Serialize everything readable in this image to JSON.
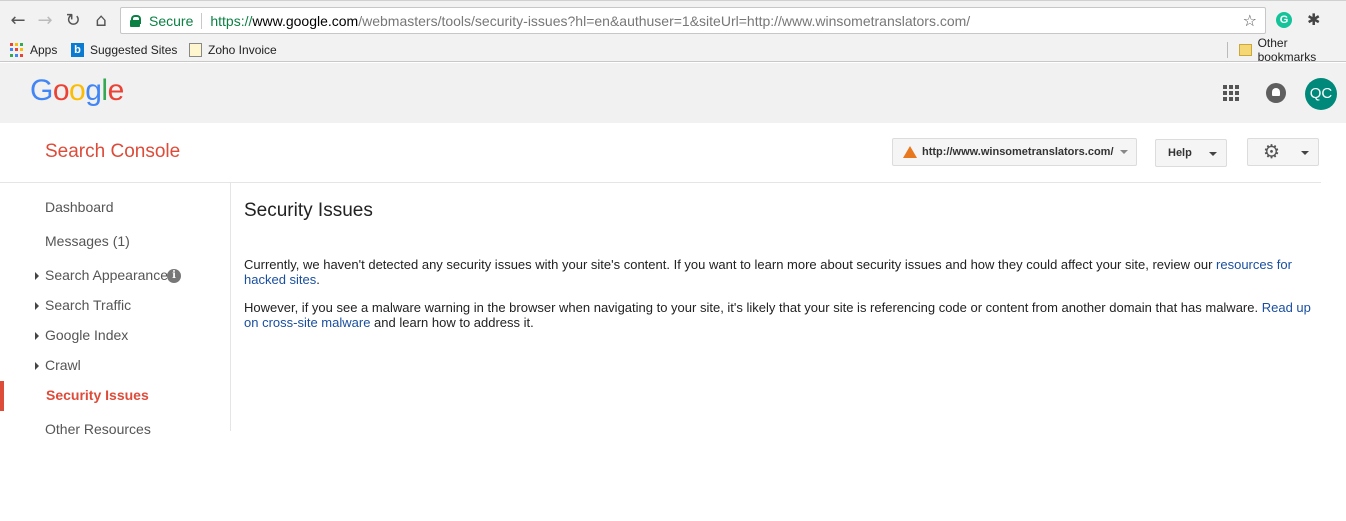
{
  "browser": {
    "secure_label": "Secure",
    "url_scheme": "https://",
    "url_host": "www.google.com",
    "url_path": "/webmasters/tools/security-issues?hl=en&authuser=1&siteUrl=http://www.winsometranslators.com/",
    "grammarly_letter": "G",
    "bookmarks": {
      "apps": "Apps",
      "suggested_sites": "Suggested Sites",
      "zoho_invoice": "Zoho Invoice",
      "suggested_letter": "b",
      "other": "Other bookmarks"
    }
  },
  "google_header": {
    "logo_letters": [
      "G",
      "o",
      "o",
      "g",
      "l",
      "e"
    ],
    "avatar_initials": "QC"
  },
  "console": {
    "title": "Search Console",
    "site_selector": "http://www.winsometranslators.com/",
    "help_label": "Help"
  },
  "sidebar": {
    "items": [
      {
        "label": "Dashboard"
      },
      {
        "label": "Messages (1)"
      },
      {
        "label": "Search Appearance"
      },
      {
        "label": "Search Traffic"
      },
      {
        "label": "Google Index"
      },
      {
        "label": "Crawl"
      },
      {
        "label": "Security Issues"
      },
      {
        "label": "Other Resources"
      }
    ],
    "info_glyph": "i"
  },
  "main": {
    "title": "Security Issues",
    "para1_text": "Currently, we haven't detected any security issues with your site's content. If you want to learn more about security issues and how they could affect your site, review our ",
    "para1_link": "resources for hacked sites",
    "para1_end": ".",
    "para2_text": "However, if you see a malware warning in the browser when navigating to your site, it's likely that your site is referencing code or content from another domain that has malware. ",
    "para2_link": "Read up on cross-site malware",
    "para2_end": " and learn how to address it."
  },
  "colors": {
    "accent_red": "#dd4b39",
    "link_blue": "#1a4fa0",
    "secure_green": "#0b8043",
    "avatar_teal": "#00897b"
  }
}
